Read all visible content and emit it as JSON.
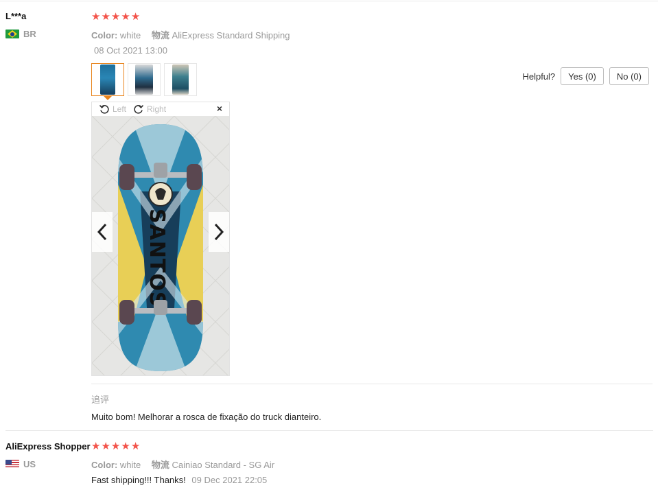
{
  "reviews": [
    {
      "user": "L***a",
      "country": "BR",
      "rating": 5,
      "color_label": "Color:",
      "color_value": "white",
      "logistics_label": "物流",
      "logistics_value": "AliExpress Standard Shipping",
      "date": "08 Oct 2021 13:00",
      "helpful_label": "Helpful?",
      "yes_label": "Yes (0)",
      "no_label": "No (0)",
      "viewer": {
        "rotate_left": "Left",
        "rotate_right": "Right",
        "close": "×"
      },
      "append_label": "追评",
      "append_text": "Muito bom! Melhorar a rosca de fixação do truck dianteiro."
    },
    {
      "user": "AliExpress Shopper",
      "country": "US",
      "rating": 5,
      "color_label": "Color:",
      "color_value": "white",
      "logistics_label": "物流",
      "logistics_value": "Cainiao Standard - SG Air",
      "text": "Fast shipping!!! Thanks!",
      "date": "09 Dec 2021 22:05"
    }
  ],
  "colors": {
    "star": "#f3534a",
    "active_thumb": "#e8841c"
  },
  "icons": [
    "star-icon",
    "rotate-left-icon",
    "rotate-right-icon",
    "close-icon",
    "chevron-left-icon",
    "chevron-right-icon"
  ]
}
